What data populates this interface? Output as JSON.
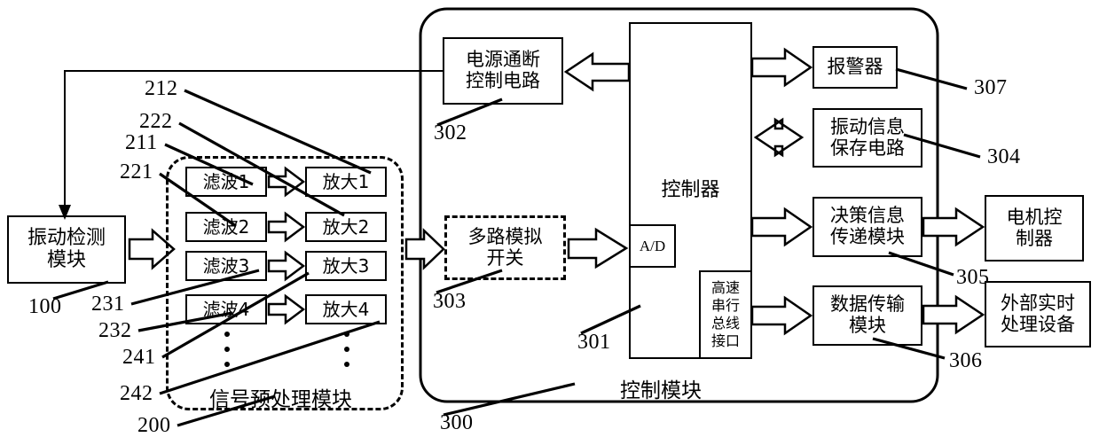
{
  "diagram": {
    "title_caption_left": "信号预处理模块",
    "title_caption_right": "控制模块",
    "boxes": {
      "vibration_detection": "振动检测\n模块",
      "filters": [
        "滤波1",
        "滤波2",
        "滤波3",
        "滤波4"
      ],
      "amplifiers": [
        "放大1",
        "放大2",
        "放大3",
        "放大4"
      ],
      "power_control": "电源通断\n控制电路",
      "multiplexer": "多路模拟\n开关",
      "controller": "控制器",
      "adc": "A/D",
      "serial_bus": "高速\n串行\n总线\n接口",
      "alarm": "报警器",
      "vibration_storage": "振动信息\n保存电路",
      "decision_transfer": "决策信息\n传递模块",
      "data_transmission": "数据传输\n模块",
      "motor_controller": "电机控\n制器",
      "external_device": "外部实时\n处理设备"
    },
    "reference_numbers": {
      "n100": "100",
      "n200": "200",
      "n211": "211",
      "n212": "212",
      "n221": "221",
      "n222": "222",
      "n231": "231",
      "n232": "232",
      "n241": "241",
      "n242": "242",
      "n300": "300",
      "n301": "301",
      "n302": "302",
      "n303": "303",
      "n304": "304",
      "n305": "305",
      "n306": "306",
      "n307": "307"
    },
    "colors": {
      "stroke": "#000000",
      "background": "#ffffff"
    }
  }
}
